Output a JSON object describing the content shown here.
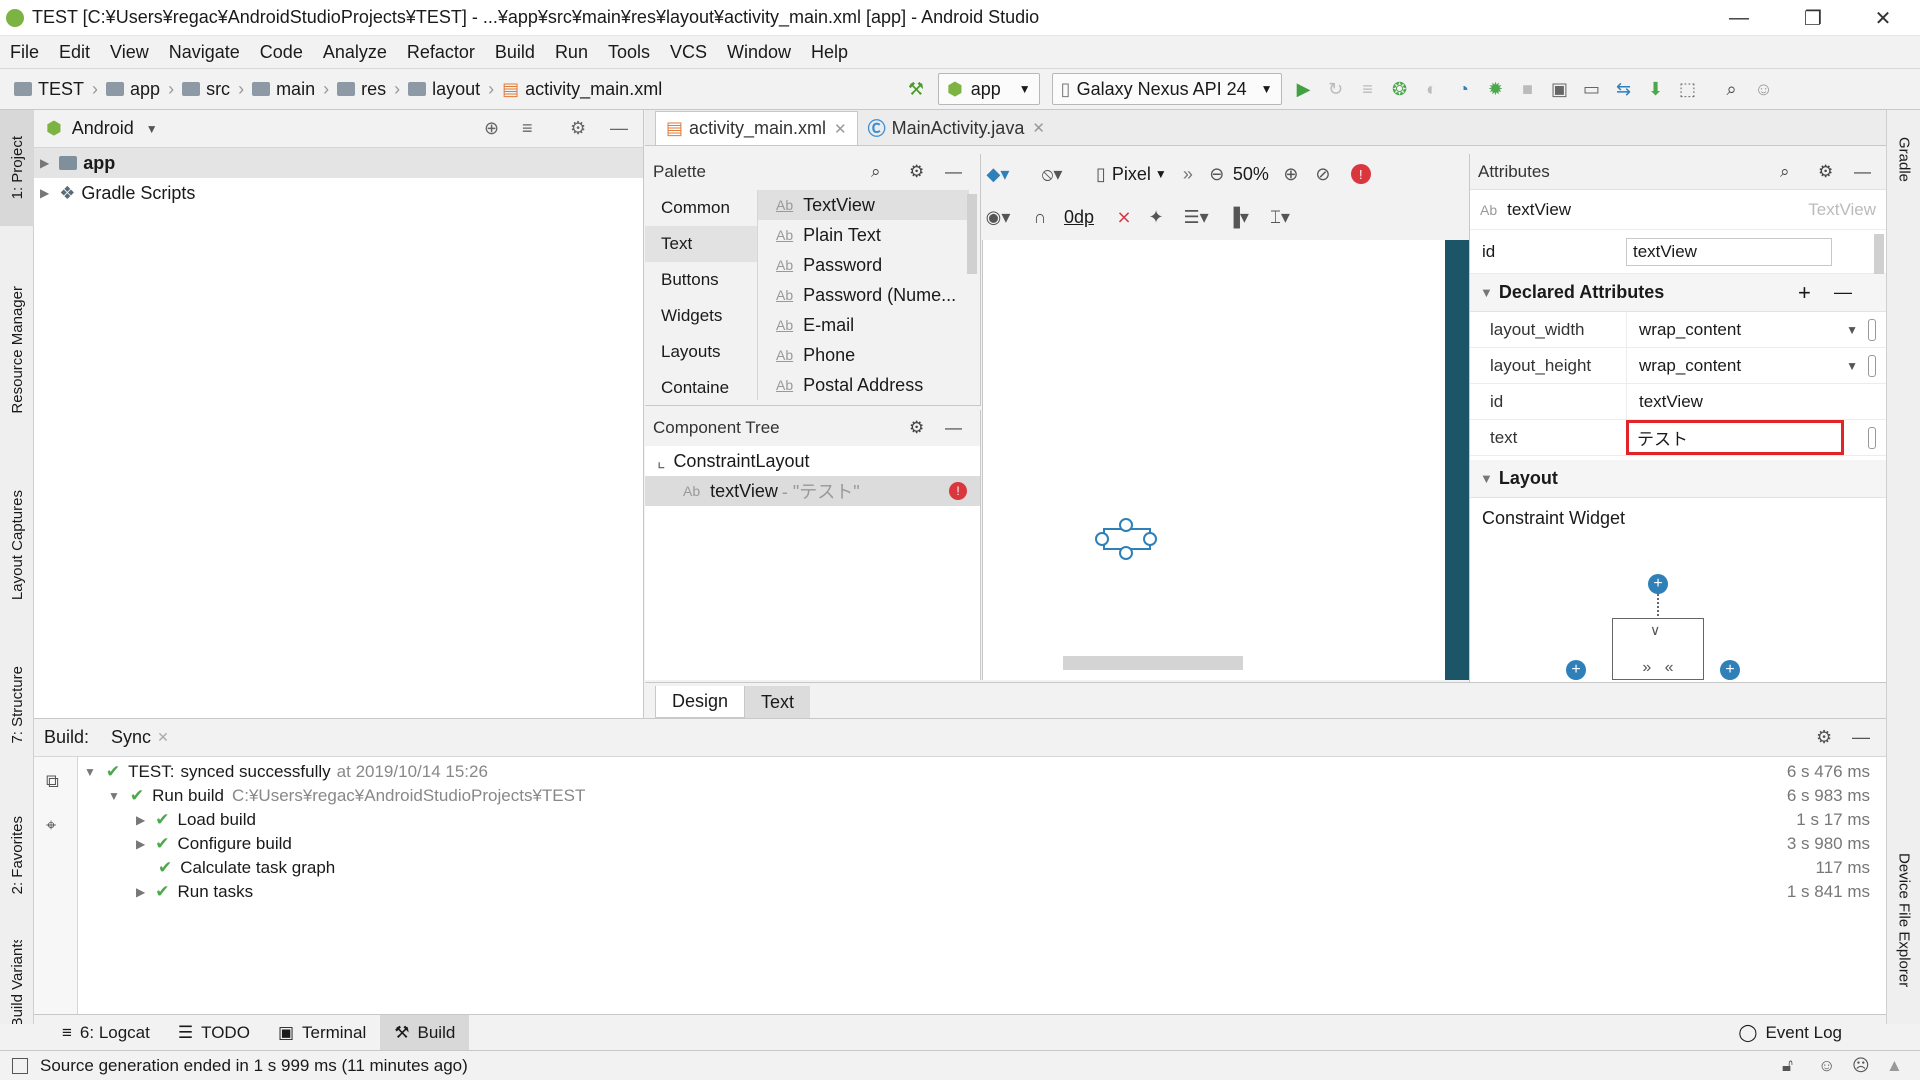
{
  "window": {
    "title": "TEST [C:¥Users¥regac¥AndroidStudioProjects¥TEST] - ...¥app¥src¥main¥res¥layout¥activity_main.xml [app] - Android Studio"
  },
  "menu": [
    "File",
    "Edit",
    "View",
    "Navigate",
    "Code",
    "Analyze",
    "Refactor",
    "Build",
    "Run",
    "Tools",
    "VCS",
    "Window",
    "Help"
  ],
  "breadcrumbs": [
    "TEST",
    "app",
    "src",
    "main",
    "res",
    "layout",
    "activity_main.xml"
  ],
  "toolbar": {
    "run_config": "app",
    "device": "Galaxy Nexus API 24"
  },
  "left_tabs": [
    "1: Project",
    "Resource Manager",
    "Layout Captures",
    "7: Structure",
    "2: Favorites",
    "Build Variants"
  ],
  "right_tabs": [
    "Gradle",
    "Device File Explorer"
  ],
  "project": {
    "view_mode": "Android",
    "tree": [
      {
        "label": "app"
      },
      {
        "label": "Gradle Scripts"
      }
    ]
  },
  "editor_tabs": [
    {
      "label": "activity_main.xml"
    },
    {
      "label": "MainActivity.java"
    }
  ],
  "palette": {
    "title": "Palette",
    "categories": [
      "Common",
      "Text",
      "Buttons",
      "Widgets",
      "Layouts",
      "Containe"
    ],
    "selected_category": "Text",
    "items": [
      "TextView",
      "Plain Text",
      "Password",
      "Password (Nume...",
      "E-mail",
      "Phone",
      "Postal Address"
    ]
  },
  "component_tree": {
    "title": "Component Tree",
    "root": "ConstraintLayout",
    "child": "textView",
    "child_text": "- \"テスト\""
  },
  "canvas_toolbar": {
    "device": "Pixel",
    "zoom": "50%",
    "margin": "0dp"
  },
  "attributes": {
    "title": "Attributes",
    "component": "textView",
    "component_type": "TextView",
    "id_label": "id",
    "id_value": "textView",
    "declared_title": "Declared Attributes",
    "rows": [
      {
        "name": "layout_width",
        "value": "wrap_content"
      },
      {
        "name": "layout_height",
        "value": "wrap_content"
      },
      {
        "name": "id",
        "value": "textView"
      },
      {
        "name": "text",
        "value": "テスト"
      }
    ],
    "layout_title": "Layout",
    "constraint_widget": "Constraint Widget"
  },
  "design_tabs": [
    "Design",
    "Text"
  ],
  "build": {
    "tabs": [
      "Build:",
      "Sync"
    ],
    "rows": [
      {
        "label": "TEST:",
        "label2": "synced successfully",
        "detail": "at 2019/10/14 15:26",
        "duration": "6 s 476 ms"
      },
      {
        "label": "Run build",
        "detail": "C:¥Users¥regac¥AndroidStudioProjects¥TEST",
        "duration": "6 s 983 ms"
      },
      {
        "label": "Load build",
        "duration": "1 s 17 ms"
      },
      {
        "label": "Configure build",
        "duration": "3 s 980 ms"
      },
      {
        "label": "Calculate task graph",
        "duration": "117 ms"
      },
      {
        "label": "Run tasks",
        "duration": "1 s 841 ms"
      }
    ]
  },
  "tool_tabs": [
    "6: Logcat",
    "TODO",
    "Terminal",
    "Build"
  ],
  "event_log": "Event Log",
  "status": "Source generation ended in 1 s 999 ms (11 minutes ago)"
}
